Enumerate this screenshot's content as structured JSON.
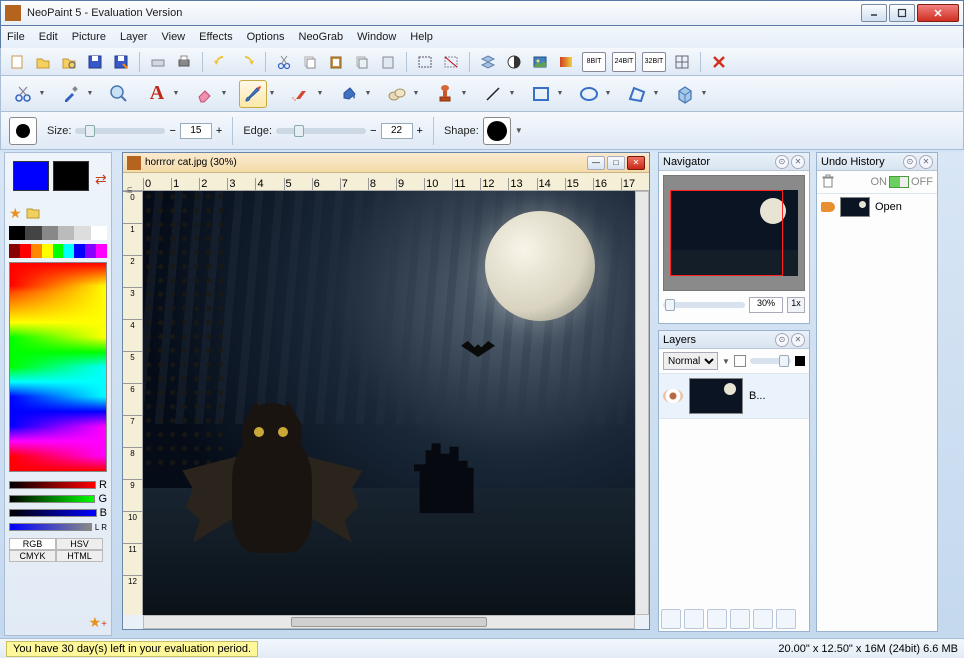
{
  "app": {
    "title": "NeoPaint 5 - Evaluation Version"
  },
  "menu": [
    "File",
    "Edit",
    "Picture",
    "Layer",
    "View",
    "Effects",
    "Options",
    "NeoGrab",
    "Window",
    "Help"
  ],
  "brush": {
    "size_label": "Size:",
    "size_value": "15",
    "edge_label": "Edge:",
    "edge_value": "22",
    "shape_label": "Shape:"
  },
  "palette": {
    "modes": [
      "RGB",
      "HSV",
      "CMYK",
      "HTML"
    ],
    "rgb_labels": [
      "R",
      "G",
      "B"
    ],
    "mixer_label": "L  R"
  },
  "canvas": {
    "title": "horrror cat.jpg (30%)",
    "ruler_unit": "in",
    "ruler_h": [
      "0",
      "1",
      "2",
      "3",
      "4",
      "5",
      "6",
      "7",
      "8",
      "9",
      "10",
      "11",
      "12",
      "13",
      "14",
      "15",
      "16",
      "17"
    ],
    "ruler_v": [
      "0",
      "1",
      "2",
      "3",
      "4",
      "5",
      "6",
      "7",
      "8",
      "9",
      "10",
      "11",
      "12"
    ]
  },
  "navigator": {
    "title": "Navigator",
    "zoom": "30%",
    "reset": "1x"
  },
  "layers": {
    "title": "Layers",
    "blend_mode": "Normal",
    "items": [
      {
        "name": "B..."
      }
    ]
  },
  "undo": {
    "title": "Undo History",
    "on_label": "ON",
    "off_label": "OFF",
    "items": [
      {
        "label": "Open"
      }
    ]
  },
  "status": {
    "eval_msg": "You have 30 day(s) left in your evaluation period.",
    "dims": "20.00\" x 12.50\" x 16M (24bit) 6.6 MB"
  },
  "btn_labels": {
    "plus": "+",
    "minus": "−"
  }
}
